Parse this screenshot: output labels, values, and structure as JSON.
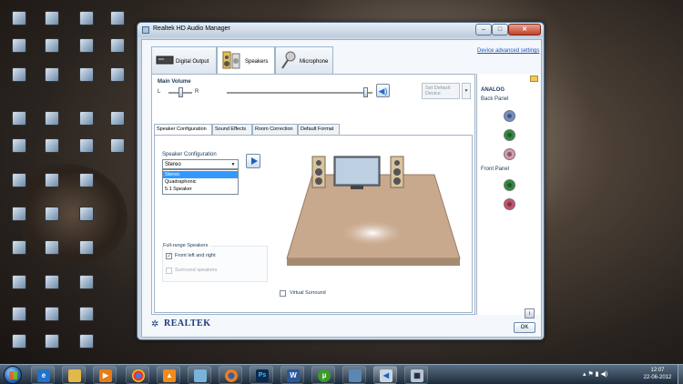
{
  "window": {
    "title": "Realtek HD Audio Manager",
    "minimize": "–",
    "maximize": "□",
    "close": "✕"
  },
  "tabs": [
    {
      "label": "Digital Output"
    },
    {
      "label": "Speakers"
    },
    {
      "label": "Microphone"
    }
  ],
  "device_advanced_settings": "Device advanced settings",
  "main_volume": {
    "title": "Main Volume",
    "left": "L",
    "right": "R",
    "set_default_device": "Set Default Device",
    "balance_level": 0.5,
    "volume_level": 0.95
  },
  "sub_tabs": [
    "Speaker Configuration",
    "Sound Effects",
    "Room Correction",
    "Default Format"
  ],
  "speaker_configuration": {
    "label": "Speaker Configuration",
    "selected": "Stereo",
    "options": [
      "Stereo",
      "Quadraphonic",
      "5.1 Speaker"
    ]
  },
  "full_range": {
    "title": "Full-range Speakers",
    "front": "Front left and right",
    "surround": "Surround speakers",
    "front_checked": true,
    "surround_checked": false
  },
  "virtual_surround": {
    "label": "Virtual Surround",
    "checked": false
  },
  "analog": {
    "title": "ANALOG",
    "back_panel": "Back Panel",
    "front_panel": "Front Panel",
    "back_jacks": [
      "#6f8fc7",
      "#2e8a3e",
      "#d899ae"
    ],
    "front_jacks": [
      "#2e8a3e",
      "#c9506d"
    ]
  },
  "brand": "REALTEK",
  "info_button": "i",
  "ok_button": "OK",
  "taskbar": {
    "time": "12:07",
    "date": "22-06-2012"
  }
}
